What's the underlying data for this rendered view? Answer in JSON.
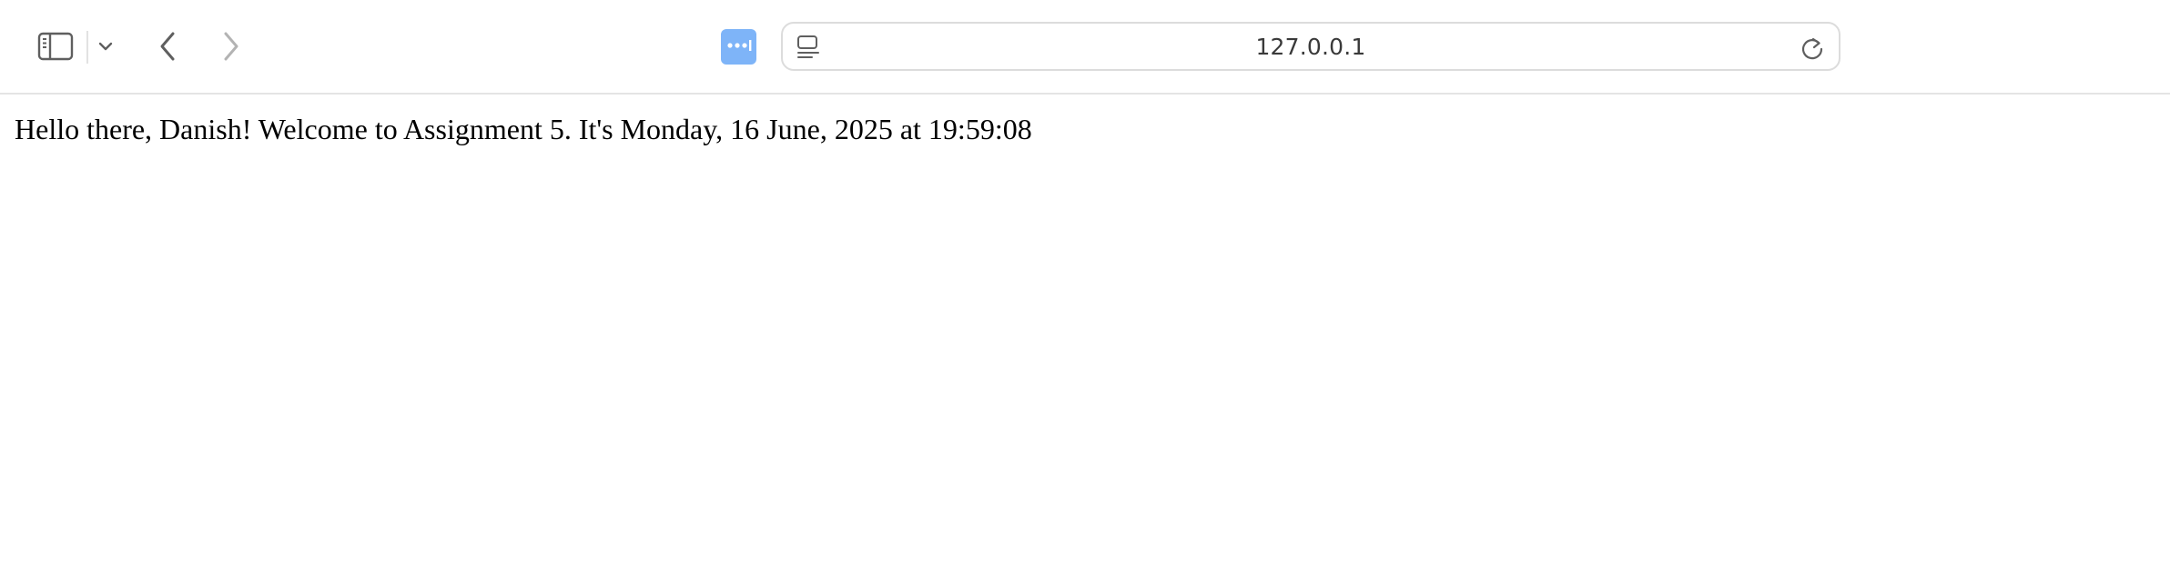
{
  "browser": {
    "address": "127.0.0.1",
    "toolbar_icons": {
      "sidebar": "sidebar-icon",
      "tab_group": "chevron-down-icon",
      "back": "chevron-left-icon",
      "forward": "chevron-right-icon",
      "extension": "more-dots-icon",
      "reader": "reader-mode-icon",
      "reload": "reload-icon"
    },
    "colors": {
      "extension_accent": "#7eb4f8",
      "icon_dark": "#5f5f5f",
      "icon_disabled": "#b3b3b3"
    }
  },
  "page": {
    "greeting": "Hello there, Danish! Welcome to Assignment 5. It's Monday, 16 June, 2025 at 19:59:08"
  }
}
